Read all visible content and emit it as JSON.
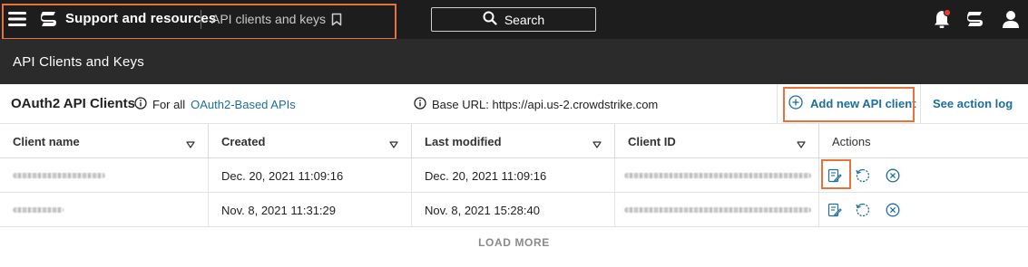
{
  "nav": {
    "title": "Support and resources",
    "breadcrumb": "API clients and keys",
    "search_label": "Search",
    "icons": [
      "menu-icon",
      "logo-icon",
      "bookmark-icon",
      "search-icon",
      "notifications-icon",
      "apps-icon",
      "user-icon"
    ],
    "notification_dot_color": "#e53935"
  },
  "page": {
    "title": "API Clients and Keys"
  },
  "toolbar": {
    "section_title": "OAuth2 API Clients",
    "for_all_prefix": "For all",
    "for_all_link": "OAuth2-Based APIs",
    "base_url": "Base URL: https://api.us-2.crowdstrike.com",
    "add_button": "Add new API client",
    "action_log": "See action log"
  },
  "table": {
    "columns": [
      "Client name",
      "Created",
      "Last modified",
      "Client ID",
      "Actions"
    ],
    "rows": [
      {
        "client_name": "",
        "created": "Dec. 20, 2021 11:09:16",
        "last_modified": "Dec. 20, 2021 11:09:16",
        "client_id": ""
      },
      {
        "client_name": "",
        "created": "Nov. 8, 2021 11:31:29",
        "last_modified": "Nov. 8, 2021 15:28:40",
        "client_id": ""
      }
    ],
    "row_actions": [
      "edit-icon",
      "reset-secret-icon",
      "delete-icon"
    ],
    "load_more": "LOAD MORE"
  },
  "colors": {
    "accent_link": "#1c6f9c",
    "highlight": "#e8733a",
    "topbar": "#1d1d1d",
    "header": "#2b2b2b"
  }
}
